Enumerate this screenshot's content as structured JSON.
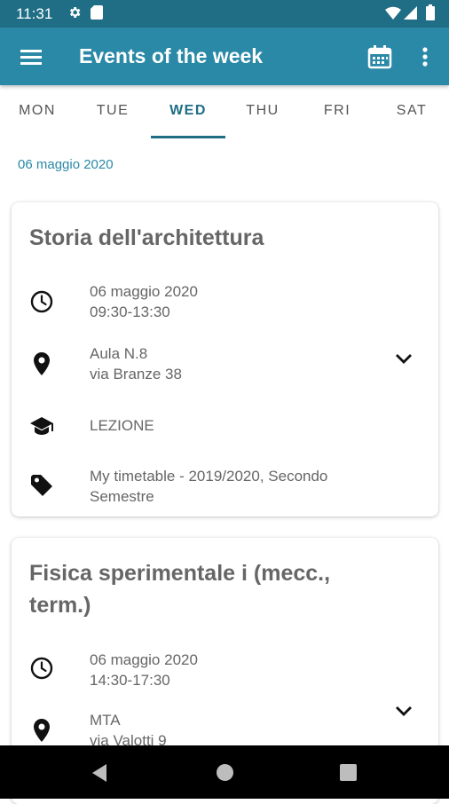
{
  "status_bar": {
    "time": "11:31",
    "icons": [
      "gear-icon",
      "sd-card-icon",
      "wifi-icon",
      "signal-icon",
      "battery-icon"
    ]
  },
  "app_bar": {
    "title": "Events of the week",
    "menu_icon": "hamburger-menu-icon",
    "calendar_icon": "calendar-icon",
    "overflow_icon": "more-vert-icon"
  },
  "tabs": [
    {
      "label": "MON",
      "active": false
    },
    {
      "label": "TUE",
      "active": false
    },
    {
      "label": "WED",
      "active": true
    },
    {
      "label": "THU",
      "active": false
    },
    {
      "label": "FRI",
      "active": false
    },
    {
      "label": "SAT",
      "active": false
    }
  ],
  "date_header": "06 maggio 2020",
  "events": [
    {
      "title": "Storia dell'architettura",
      "date": "06 maggio 2020",
      "time": "09:30-13:30",
      "room": "Aula N.8",
      "address": "via Branze 38",
      "type": "LEZIONE",
      "tag_line1": "My timetable - 2019/2020, Secondo",
      "tag_line2": "Semestre"
    },
    {
      "title_line1": "Fisica sperimentale i (mecc.,",
      "title_line2": "term.)",
      "date": "06 maggio 2020",
      "time": "14:30-17:30",
      "room": "MTA",
      "address": "via Valotti 9"
    }
  ],
  "colors": {
    "primary": "#2a89a7",
    "primary_dark": "#1f6e86",
    "text_secondary": "#666666"
  },
  "nav_bar": {
    "back_icon": "back-triangle-icon",
    "home_icon": "home-circle-icon",
    "recents_icon": "recents-square-icon"
  }
}
